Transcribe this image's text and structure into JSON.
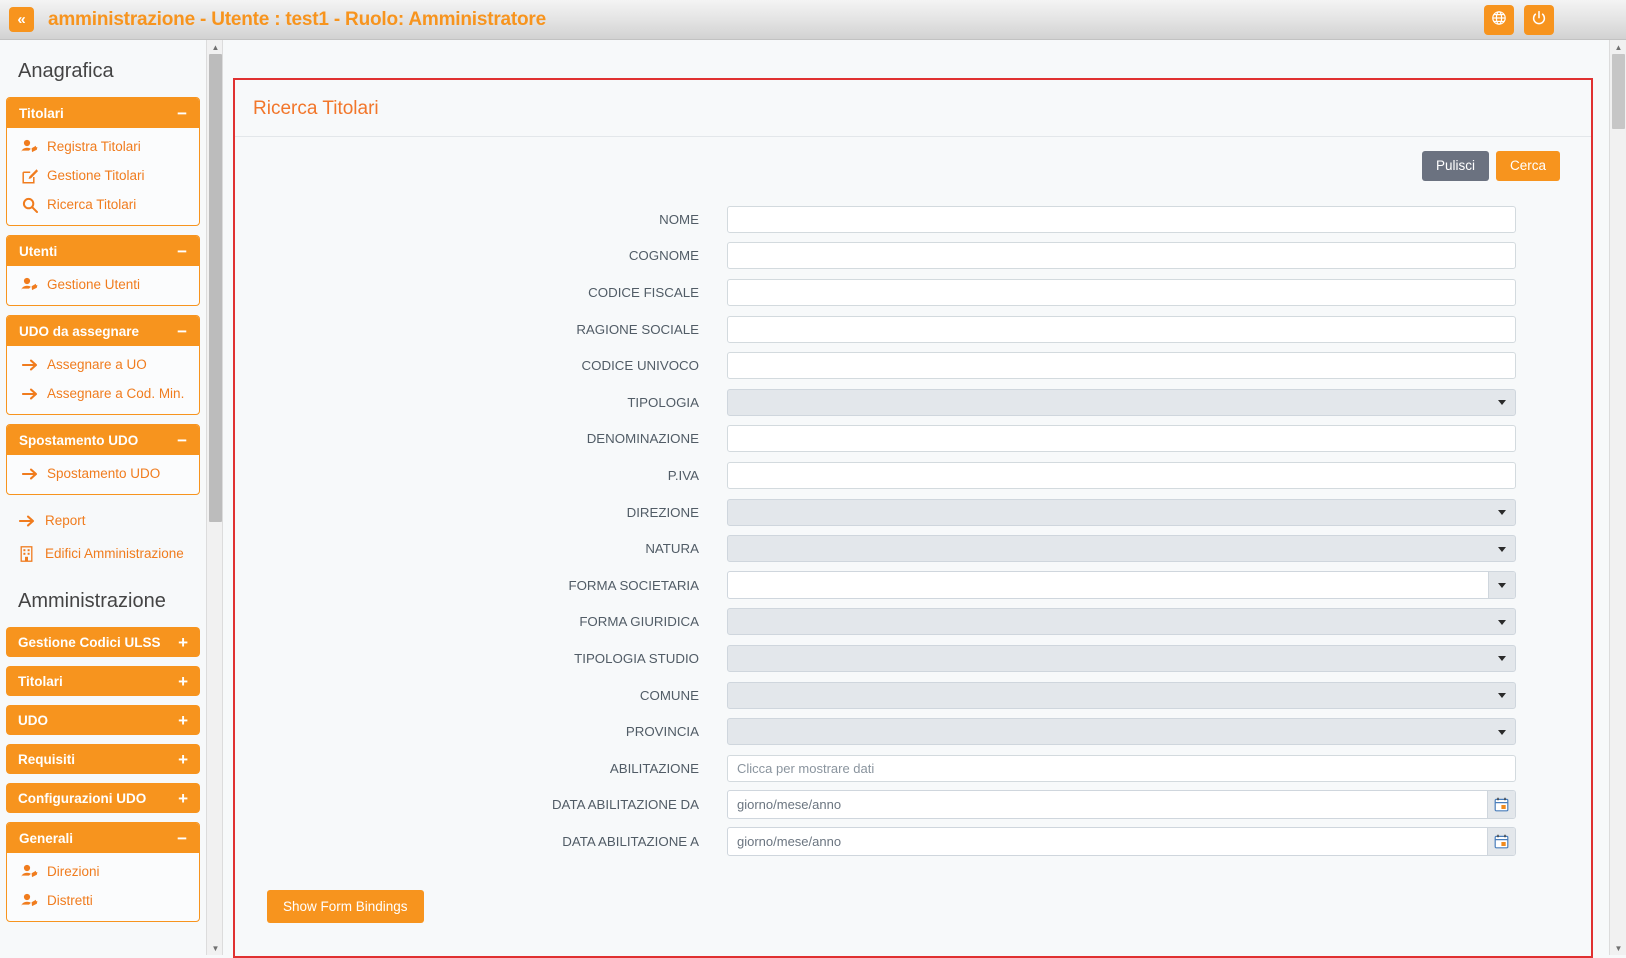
{
  "topbar": {
    "collapse_label": "«",
    "title": "amministrazione - Utente : test1 - Ruolo: Amministratore",
    "language_icon": "globe-icon",
    "logout_icon": "power-icon",
    "accent": "#f7941e"
  },
  "sidebar": {
    "sections": [
      {
        "heading": "Anagrafica",
        "panels": [
          {
            "label": "Titolari",
            "state": "open",
            "sign": "−",
            "items": [
              {
                "label": "Registra Titolari",
                "icon": "user-add-icon"
              },
              {
                "label": "Gestione Titolari",
                "icon": "edit-square-icon"
              },
              {
                "label": "Ricerca Titolari",
                "icon": "search-icon"
              }
            ]
          },
          {
            "label": "Utenti",
            "state": "open",
            "sign": "−",
            "items": [
              {
                "label": "Gestione Utenti",
                "icon": "user-add-icon"
              }
            ]
          },
          {
            "label": "UDO da assegnare",
            "state": "open",
            "sign": "−",
            "items": [
              {
                "label": "Assegnare a UO",
                "icon": "arrow-right-icon"
              },
              {
                "label": "Assegnare a Cod. Min.",
                "icon": "arrow-right-icon"
              }
            ]
          },
          {
            "label": "Spostamento UDO",
            "state": "open",
            "sign": "−",
            "items": [
              {
                "label": "Spostamento UDO",
                "icon": "arrow-right-icon"
              }
            ]
          }
        ],
        "loose_items": [
          {
            "label": "Report",
            "icon": "arrow-right-icon"
          },
          {
            "label": "Edifici Amministrazione",
            "icon": "building-icon"
          }
        ]
      },
      {
        "heading": "Amministrazione",
        "panels": [
          {
            "label": "Gestione Codici ULSS",
            "state": "closed",
            "sign": "+",
            "items": []
          },
          {
            "label": "Titolari",
            "state": "closed",
            "sign": "+",
            "items": []
          },
          {
            "label": "UDO",
            "state": "closed",
            "sign": "+",
            "items": []
          },
          {
            "label": "Requisiti",
            "state": "closed",
            "sign": "+",
            "items": []
          },
          {
            "label": "Configurazioni UDO",
            "state": "closed",
            "sign": "+",
            "items": []
          },
          {
            "label": "Generali",
            "state": "open",
            "sign": "−",
            "items": [
              {
                "label": "Direzioni",
                "icon": "user-add-icon"
              },
              {
                "label": "Distretti",
                "icon": "user-add-icon"
              }
            ]
          }
        ],
        "loose_items": []
      }
    ]
  },
  "card": {
    "title": "Ricerca Titolari",
    "border_color": "#e03131",
    "actions": {
      "clear_label": "Pulisci",
      "search_label": "Cerca"
    },
    "form": {
      "fields": [
        {
          "label": "NOME",
          "type": "text",
          "value": "",
          "placeholder": ""
        },
        {
          "label": "COGNOME",
          "type": "text",
          "value": "",
          "placeholder": ""
        },
        {
          "label": "CODICE FISCALE",
          "type": "text",
          "value": "",
          "placeholder": ""
        },
        {
          "label": "RAGIONE SOCIALE",
          "type": "text",
          "value": "",
          "placeholder": ""
        },
        {
          "label": "CODICE UNIVOCO",
          "type": "text",
          "value": "",
          "placeholder": ""
        },
        {
          "label": "TIPOLOGIA",
          "type": "select",
          "value": ""
        },
        {
          "label": "DENOMINAZIONE",
          "type": "text",
          "value": "",
          "placeholder": ""
        },
        {
          "label": "P.IVA",
          "type": "text",
          "value": "",
          "placeholder": ""
        },
        {
          "label": "DIREZIONE",
          "type": "select",
          "value": ""
        },
        {
          "label": "NATURA",
          "type": "select",
          "value": ""
        },
        {
          "label": "FORMA SOCIETARIA",
          "type": "combo",
          "value": ""
        },
        {
          "label": "FORMA GIURIDICA",
          "type": "select",
          "value": ""
        },
        {
          "label": "TIPOLOGIA STUDIO",
          "type": "select",
          "value": ""
        },
        {
          "label": "COMUNE",
          "type": "select",
          "value": ""
        },
        {
          "label": "PROVINCIA",
          "type": "select",
          "value": ""
        },
        {
          "label": "ABILITAZIONE",
          "type": "text",
          "value": "",
          "placeholder": "Clicca per mostrare dati"
        },
        {
          "label": "DATA ABILITAZIONE DA",
          "type": "date",
          "value": "",
          "placeholder": "giorno/mese/anno",
          "icon": "calendar-icon"
        },
        {
          "label": "DATA ABILITAZIONE A",
          "type": "date",
          "value": "",
          "placeholder": "giorno/mese/anno",
          "icon": "calendar-icon"
        }
      ],
      "bindings_button_label": "Show Form Bindings"
    }
  }
}
